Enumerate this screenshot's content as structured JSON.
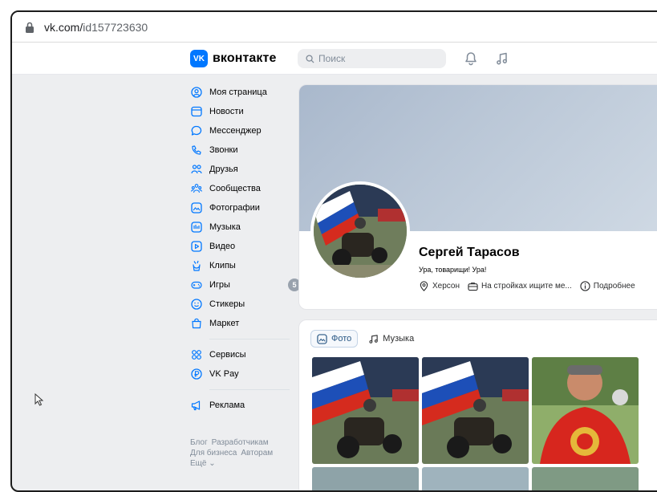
{
  "browser": {
    "url_host": "vk.com/",
    "url_path": "id157723630"
  },
  "header": {
    "logo_badge": "VK",
    "logo_text": "вконтакте",
    "search_placeholder": "Поиск"
  },
  "sidebar": {
    "items": [
      {
        "label": "Моя страница",
        "icon": "user-circle-icon"
      },
      {
        "label": "Новости",
        "icon": "news-icon"
      },
      {
        "label": "Мессенджер",
        "icon": "chat-bubble-icon"
      },
      {
        "label": "Звонки",
        "icon": "phone-icon"
      },
      {
        "label": "Друзья",
        "icon": "friends-icon"
      },
      {
        "label": "Сообщества",
        "icon": "communities-icon"
      },
      {
        "label": "Фотографии",
        "icon": "photo-icon"
      },
      {
        "label": "Музыка",
        "icon": "music-icon"
      },
      {
        "label": "Видео",
        "icon": "video-icon"
      },
      {
        "label": "Клипы",
        "icon": "clips-icon"
      },
      {
        "label": "Игры",
        "icon": "gamepad-icon",
        "badge": "5"
      },
      {
        "label": "Стикеры",
        "icon": "smile-icon"
      },
      {
        "label": "Маркет",
        "icon": "bag-icon"
      }
    ],
    "items2": [
      {
        "label": "Сервисы",
        "icon": "services-icon"
      },
      {
        "label": "VK Pay",
        "icon": "ruble-icon"
      }
    ],
    "items3": [
      {
        "label": "Реклама",
        "icon": "megaphone-icon"
      }
    ],
    "footer": {
      "blog": "Блог",
      "developers": "Разработчикам",
      "business": "Для бизнеса",
      "authors": "Авторам",
      "more": "Ещё ⌄"
    }
  },
  "profile": {
    "name": "Сергей Тарасов",
    "status": "Ура, товарищи! Ура!",
    "city": "Херсон",
    "job": "На стройках ищите ме...",
    "details": "Подробнее"
  },
  "media": {
    "tabs": [
      {
        "label": "Фото",
        "active": true
      },
      {
        "label": "Музыка",
        "active": false
      }
    ]
  },
  "colors": {
    "accent": "#0077ff",
    "link": "#2a5885",
    "background": "#edeef0"
  }
}
